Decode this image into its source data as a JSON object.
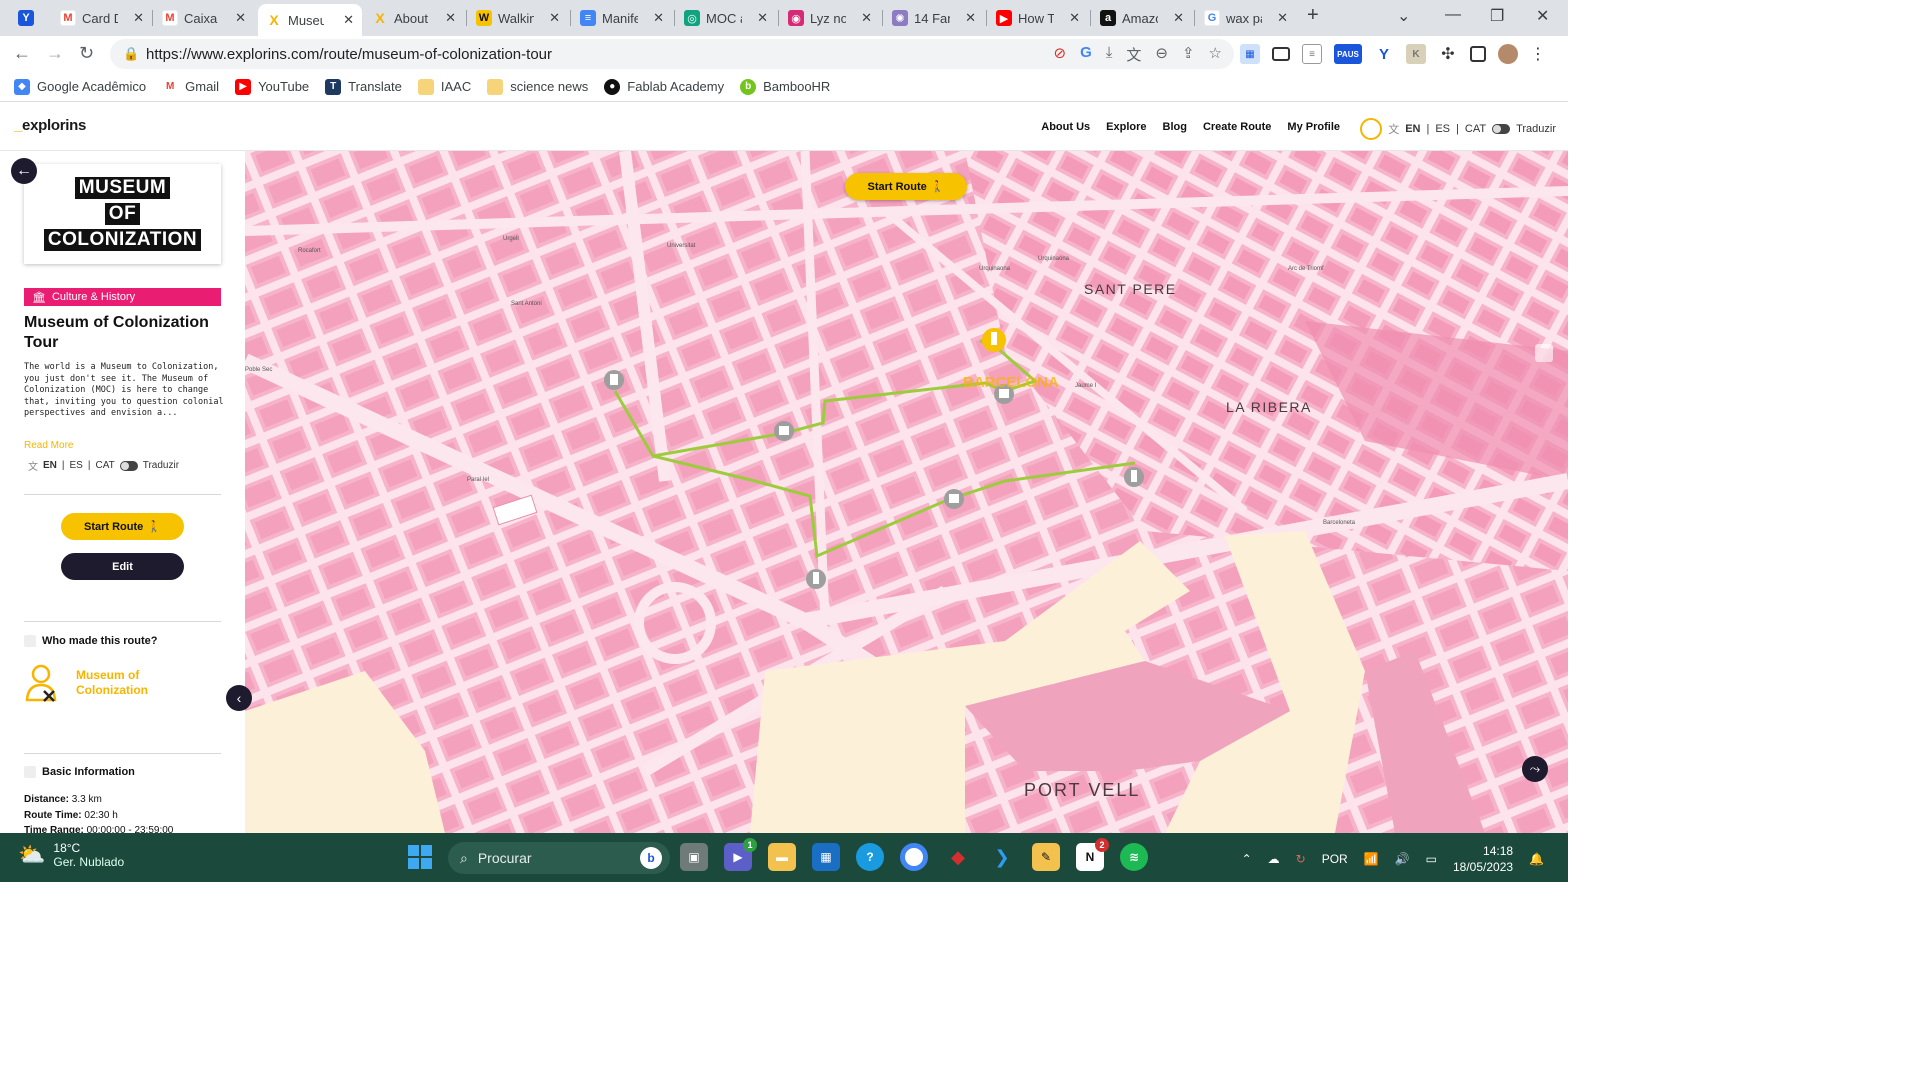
{
  "browser": {
    "tabs": [
      {
        "label": "",
        "color": "#1a56db",
        "glyph": "Y"
      },
      {
        "label": "Card D",
        "color": "#ea4335",
        "glyph": "M"
      },
      {
        "label": "Caixa d",
        "color": "#ea4335",
        "glyph": "M"
      },
      {
        "label": "Museu",
        "color": "#f7b500",
        "glyph": "X",
        "active": true
      },
      {
        "label": "About",
        "color": "#f7b500",
        "glyph": "X"
      },
      {
        "label": "Walkin",
        "color": "#222",
        "glyph": "W"
      },
      {
        "label": "Manife",
        "color": "#4285f4",
        "glyph": "≡"
      },
      {
        "label": "MOC a",
        "color": "#10a37f",
        "glyph": "◎"
      },
      {
        "label": "Lyz no",
        "color": "#d62976",
        "glyph": "◉"
      },
      {
        "label": "14 Fan",
        "color": "#8e7cc3",
        "glyph": "✺"
      },
      {
        "label": "How Tc",
        "color": "#ff0000",
        "glyph": "▶"
      },
      {
        "label": "Amazo",
        "color": "#111",
        "glyph": "a"
      },
      {
        "label": "wax pa",
        "color": "#4285f4",
        "glyph": "G"
      }
    ],
    "url": "https://www.explorins.com/route/museum-of-colonization-tour",
    "bookmarks": [
      {
        "label": "Google Acadêmico",
        "color": "#4285f4",
        "glyph": "◆"
      },
      {
        "label": "Gmail",
        "color": "#ea4335",
        "glyph": "M"
      },
      {
        "label": "YouTube",
        "color": "#ff0000",
        "glyph": "▶"
      },
      {
        "label": "Translate",
        "color": "#1e3a5f",
        "glyph": "T"
      },
      {
        "label": "IAAC",
        "color": "#f6d57a",
        "glyph": ""
      },
      {
        "label": "science news",
        "color": "#f6d57a",
        "glyph": ""
      },
      {
        "label": "Fablab Academy",
        "color": "#111",
        "glyph": "●"
      },
      {
        "label": "BambooHR",
        "color": "#73c41d",
        "glyph": "b"
      }
    ],
    "extensions": {
      "paus_label": "PAUS"
    }
  },
  "site": {
    "logo": "explorins",
    "nav": [
      "About Us",
      "Explore",
      "Blog",
      "Create Route",
      "My Profile"
    ],
    "lang": {
      "en": "EN",
      "es": "ES",
      "cat": "CAT",
      "translate": "Traduzir"
    }
  },
  "sidebar": {
    "cover_lines": [
      "MUSEUM",
      "OF",
      "COLONIZATION"
    ],
    "tag": "Culture & History",
    "title": "Museum of Colonization Tour",
    "description": "The world is a Museum to Colonization, you just don't see it. The Museum of Colonization (MOC) is here to change that, inviting you to question colonial perspectives and envision a...",
    "read_more": "Read More",
    "start_label": "Start Route",
    "edit_label": "Edit",
    "who_made": "Who made this route?",
    "author": "Museum of Colonization",
    "basic_info": "Basic Information",
    "distance_label": "Distance:",
    "distance_value": "3.3 km",
    "time_label": "Route Time:",
    "time_value": "02:30 h",
    "range_label": "Time Range:",
    "range_value": "00:00:00 - 23:59:00"
  },
  "map": {
    "start_label": "Start Route",
    "areas": {
      "sant_pere": "SANT PERE",
      "la_ribera": "LA RIBERA",
      "port_vell": "PORT VELL",
      "city": "BARCELONA"
    },
    "small_labels": [
      "Rocafort",
      "Urgell",
      "Universitat",
      "Urquinaona",
      "Urquinaona",
      "Arc de Triomf",
      "Sant Antoni",
      "Poble Sec",
      "Paral·lel",
      "Jaume I",
      "Barceloneta"
    ],
    "route_color": "#9ccc3c",
    "colors": {
      "land": "#f4a6c0",
      "block": "#f7bcd1",
      "street": "#fde3ec",
      "water": "#fdf0d8"
    }
  },
  "taskbar": {
    "temp": "18°C",
    "weather": "Ger. Nublado",
    "search": "Procurar",
    "lang": "POR",
    "time": "14:18",
    "date": "18/05/2023",
    "teams_badge": "1",
    "notion_badge": "2"
  }
}
